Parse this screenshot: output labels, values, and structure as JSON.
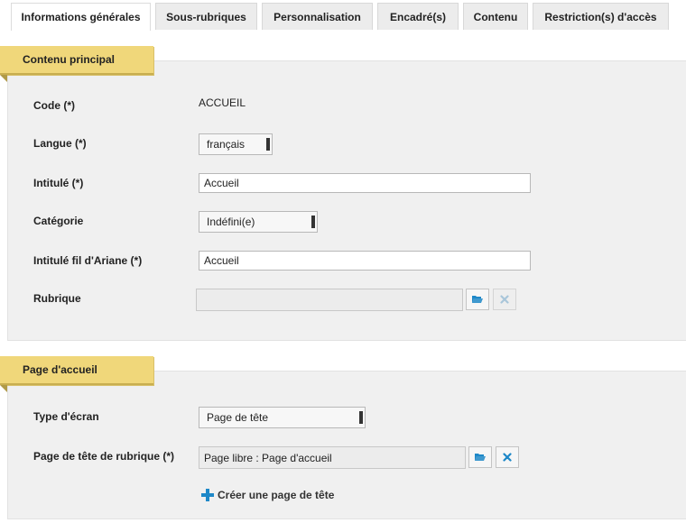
{
  "tabs": [
    {
      "label": "Informations générales",
      "active": true
    },
    {
      "label": "Sous-rubriques",
      "active": false
    },
    {
      "label": "Personnalisation",
      "active": false
    },
    {
      "label": "Encadré(s)",
      "active": false
    },
    {
      "label": "Contenu",
      "active": false
    },
    {
      "label": "Restriction(s) d'accès",
      "active": false
    }
  ],
  "main_section": {
    "title": "Contenu principal",
    "code_label": "Code (*)",
    "code_value": "ACCUEIL",
    "langue_label": "Langue (*)",
    "langue_value": "français",
    "intitule_label": "Intitulé (*)",
    "intitule_value": "Accueil",
    "categorie_label": "Catégorie",
    "categorie_value": "Indéfini(e)",
    "ariane_label": "Intitulé fil d'Ariane (*)",
    "ariane_value": "Accueil",
    "rubrique_label": "Rubrique",
    "rubrique_value": ""
  },
  "home_section": {
    "title": "Page d'accueil",
    "type_label": "Type d'écran",
    "type_value": "Page de tête",
    "page_tete_label": "Page de tête de rubrique (*)",
    "page_tete_value": "Page libre : Page d'accueil",
    "create_link": "Créer une page de tête"
  },
  "colors": {
    "ribbon": "#f0d77a",
    "section_bg": "#f0f0f0",
    "accent_blue": "#1e88c8"
  },
  "icons": {
    "browse": "folder-open-icon",
    "clear": "close-icon",
    "create": "plus-icon"
  }
}
